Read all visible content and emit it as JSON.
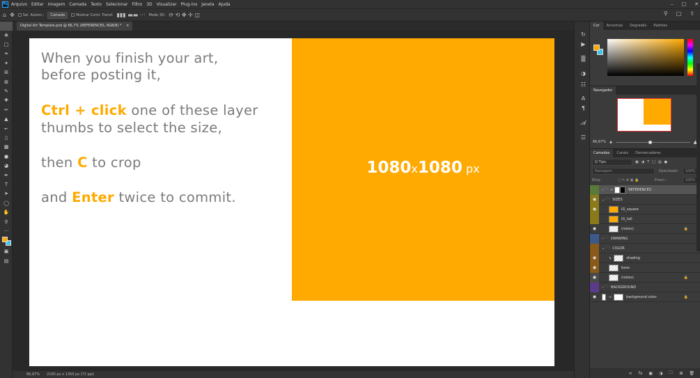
{
  "menubar": {
    "logo": "Ps",
    "items": [
      "Arquivo",
      "Editar",
      "Imagem",
      "Camada",
      "Texto",
      "Selecionar",
      "Filtro",
      "3D",
      "Visualizar",
      "Plug-ins",
      "Janela",
      "Ajuda"
    ]
  },
  "options": {
    "auto_select": "Sel. Autom.:",
    "layer_dropdown": "Camada",
    "transform_controls": "Mostrar Contr. Transf.",
    "mode_3d": "Modo 3D:"
  },
  "document_tab": {
    "title": "Digital Art Template.psd @ 66,7% (REFERENCES, RGB/8) *",
    "close": "×"
  },
  "canvas": {
    "line1": "When you finish your art,",
    "line2": "before posting it,",
    "line3_highlight": "Ctrl + click",
    "line3_rest": " one of these layer",
    "line4": "thumbs to select the size,",
    "line5_pre": "then ",
    "line5_highlight": "C",
    "line5_rest": " to crop",
    "line6_pre": "and ",
    "line6_highlight": "Enter",
    "line6_rest": " twice to commit.",
    "dim_w": "1080",
    "dim_x": "x",
    "dim_h": "1080",
    "dim_unit": " px",
    "accent_color": "#ffaa00"
  },
  "status": {
    "zoom": "66,67%",
    "size": "2160 px x 1350 px (72 ppi)"
  },
  "color_panel": {
    "tabs": [
      "Cor",
      "Amostras",
      "Degradês",
      "Padrões"
    ],
    "foreground": "#ffaa00",
    "background": "#42c3ef"
  },
  "navigator": {
    "title": "Navegador",
    "zoom": "66,67%"
  },
  "layers_panel": {
    "tabs": [
      "Camadas",
      "Canais",
      "Demarcadores"
    ],
    "filter_label": "Q Tipo",
    "blend_mode": "Passagem",
    "opacity_label": "Opacidade:",
    "opacity_value": "100%",
    "lock_label": "Bloq.:",
    "fill_label": "Preen.:",
    "fill_value": "100%",
    "layers": [
      {
        "name": "REFERENCES",
        "color": "#5a7a3a",
        "eye": false,
        "group": true,
        "selected": true
      },
      {
        "name": "SIZES",
        "color": "#8b7a1a",
        "eye": true,
        "group": true
      },
      {
        "name": "IG_square",
        "color": "#8b7a1a",
        "eye": true
      },
      {
        "name": "IG_tall",
        "color": "#8b7a1a",
        "eye": false
      },
      {
        "name": "(notes)",
        "color": "#3b3b3b",
        "eye": true,
        "lock": true
      },
      {
        "name": "DRAWING",
        "color": "#3b5a8a",
        "eye": false,
        "group": true
      },
      {
        "name": "COLOR",
        "color": "#8a5a1a",
        "eye": false,
        "group": true
      },
      {
        "name": "shading",
        "color": "#8a5a1a",
        "eye": true
      },
      {
        "name": "base",
        "color": "#8a5a1a",
        "eye": true
      },
      {
        "name": "(notes)",
        "color": "#4a4a4a",
        "eye": true,
        "lock": true
      },
      {
        "name": "BACKGROUND",
        "color": "#5a3a8a",
        "eye": false,
        "group": true
      },
      {
        "name": "background color",
        "color": "#3b3b3b",
        "eye": true,
        "lock": true
      }
    ]
  }
}
